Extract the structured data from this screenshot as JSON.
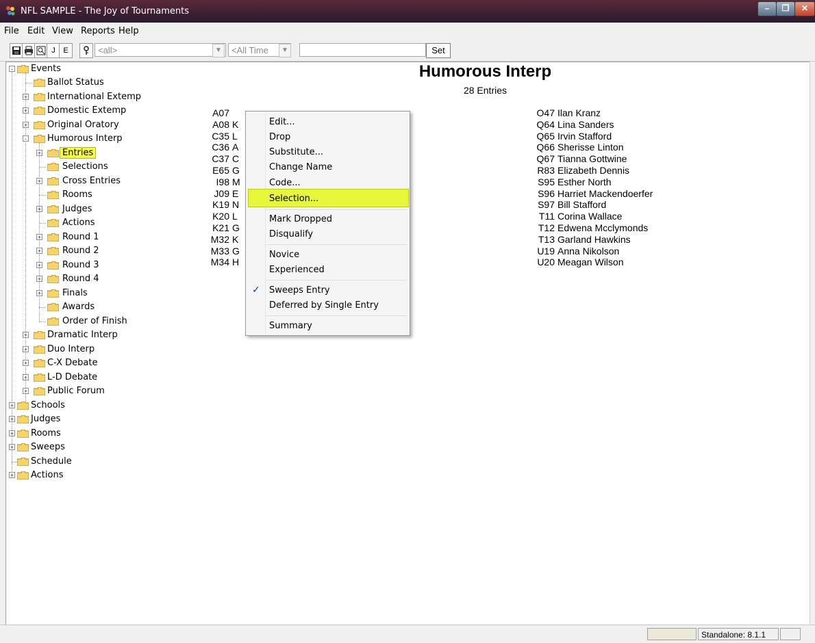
{
  "window": {
    "title": "NFL SAMPLE - The Joy of Tournaments"
  },
  "menu": [
    "File",
    "Edit",
    "View",
    "Reports",
    "Help"
  ],
  "toolbar": {
    "buttons": [
      "J",
      "E"
    ],
    "combo_all": "<all>",
    "combo_time": "<All Time",
    "text_value": "",
    "set_label": "Set"
  },
  "tree": {
    "items": [
      {
        "label": "Events",
        "expand": "-"
      },
      {
        "label": "Ballot Status"
      },
      {
        "label": "International Extemp",
        "expand": "+"
      },
      {
        "label": "Domestic Extemp",
        "expand": "+"
      },
      {
        "label": "Original Oratory",
        "expand": "+"
      },
      {
        "label": "Humorous Interp",
        "expand": "-"
      },
      {
        "label": "Entries",
        "expand": "+",
        "selected": true
      },
      {
        "label": "Selections"
      },
      {
        "label": "Cross Entries",
        "expand": "+"
      },
      {
        "label": "Rooms"
      },
      {
        "label": "Judges",
        "expand": "+"
      },
      {
        "label": "Actions"
      },
      {
        "label": "Round 1",
        "expand": "+"
      },
      {
        "label": "Round 2",
        "expand": "+"
      },
      {
        "label": "Round 3",
        "expand": "+"
      },
      {
        "label": "Round 4",
        "expand": "+"
      },
      {
        "label": "Finals",
        "expand": "+"
      },
      {
        "label": "Awards"
      },
      {
        "label": "Order of Finish"
      },
      {
        "label": "Dramatic Interp",
        "expand": "+"
      },
      {
        "label": "Duo Interp",
        "expand": "+"
      },
      {
        "label": "C-X Debate",
        "expand": "+"
      },
      {
        "label": "L-D Debate",
        "expand": "+"
      },
      {
        "label": "Public Forum",
        "expand": "+"
      },
      {
        "label": "Schools",
        "expand": "+"
      },
      {
        "label": "Judges",
        "expand": "+"
      },
      {
        "label": "Rooms",
        "expand": "+"
      },
      {
        "label": "Sweeps",
        "expand": "+"
      },
      {
        "label": "Schedule"
      },
      {
        "label": "Actions",
        "expand": "+"
      }
    ]
  },
  "main": {
    "title": "Humorous Interp",
    "count": "28 Entries",
    "left_entries": [
      {
        "code": "A07",
        "name": ""
      },
      {
        "code": "A08",
        "name": "K"
      },
      {
        "code": "C35",
        "name": "L"
      },
      {
        "code": "C36",
        "name": "A"
      },
      {
        "code": "C37",
        "name": "C"
      },
      {
        "code": "E65",
        "name": "G"
      },
      {
        "code": "I98",
        "name": "M"
      },
      {
        "code": "J09",
        "name": "E"
      },
      {
        "code": "K19",
        "name": "N"
      },
      {
        "code": "K20",
        "name": "L"
      },
      {
        "code": "K21",
        "name": "G"
      },
      {
        "code": "M32",
        "name": "K"
      },
      {
        "code": "M33",
        "name": "G"
      },
      {
        "code": "M34",
        "name": "H"
      }
    ],
    "right_entries": [
      {
        "code": "O47",
        "name": "Ilan Kranz"
      },
      {
        "code": "Q64",
        "name": "Lina Sanders"
      },
      {
        "code": "Q65",
        "name": "Irvin Stafford"
      },
      {
        "code": "Q66",
        "name": "Sherisse Linton"
      },
      {
        "code": "Q67",
        "name": "Tianna Gottwine"
      },
      {
        "code": "R83",
        "name": "Elizabeth Dennis"
      },
      {
        "code": "S95",
        "name": "Esther North"
      },
      {
        "code": "S96",
        "name": "Harriet Mackendoerfer"
      },
      {
        "code": "S97",
        "name": "Bill Stafford"
      },
      {
        "code": "T11",
        "name": "Corina Wallace"
      },
      {
        "code": "T12",
        "name": "Edwena Mcclymonds"
      },
      {
        "code": "T13",
        "name": "Garland Hawkins"
      },
      {
        "code": "U19",
        "name": "Anna Nikolson"
      },
      {
        "code": "U20",
        "name": "Meagan Wilson"
      }
    ]
  },
  "context_menu": {
    "items": [
      "Edit...",
      "Drop",
      "Substitute...",
      "Change Name",
      "Code...",
      "Selection...",
      "Mark Dropped",
      "Disqualify",
      "Novice",
      "Experienced",
      "Sweeps Entry",
      "Deferred by Single Entry",
      "Summary"
    ],
    "highlighted": "Selection...",
    "checked": "Sweeps Entry"
  },
  "status": {
    "version": "Standalone: 8.1.1"
  },
  "colors": {
    "highlight": "#e6f63a",
    "selected_tree": "#f8ff3d",
    "title_bar": "#3b1f33"
  }
}
